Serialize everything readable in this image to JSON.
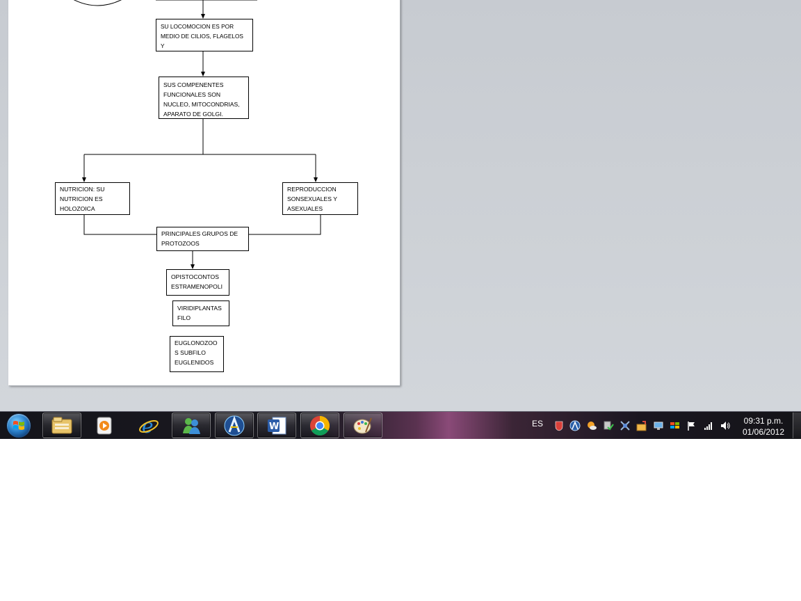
{
  "diagram": {
    "nodes": {
      "locomocion": "SU LOCOMOCION ES POR\nMEDIO DE CILIOS, FLAGELOS Y\nPSEUDOPODOS",
      "componentes": "SUS COMPENENTES\nFUNCIONALES SON\nNUCLEO, MITOCONDRIAS,\nAPARATO DE GOLGI.",
      "nutricion": "NUTRICION: SU\nNUTRICION ES\nHOLOZOICA",
      "reproduccion": "REPRODUCCION\nSONSEXUALES Y\nASEXUALES",
      "grupos": "PRINCIPALES GRUPOS DE\nPROTOZOOS",
      "opistocontos": "OPISTOCONTOS\nESTRAMENOPOLI",
      "viridiplantas": "VIRIDIPLANTAS\nFILO",
      "euglenozoos": "EUGLONOZOO\nS SUBFILO\nEUGLENIDOS"
    }
  },
  "taskbar": {
    "apps": [
      {
        "name": "explorer",
        "icon": "folder-icon",
        "open": true
      },
      {
        "name": "media-player",
        "icon": "media-player-icon",
        "open": false
      },
      {
        "name": "internet-explorer",
        "icon": "ie-icon",
        "open": false
      },
      {
        "name": "messenger",
        "icon": "messenger-icon",
        "open": true
      },
      {
        "name": "arcsoft",
        "icon": "arc-logo-icon",
        "open": true
      },
      {
        "name": "word",
        "icon": "word-icon",
        "open": true
      },
      {
        "name": "chrome",
        "icon": "chrome-icon",
        "open": true
      },
      {
        "name": "paint",
        "icon": "paint-palette-icon",
        "open": true
      }
    ],
    "tray": {
      "language": "ES",
      "icons": [
        "shield-icon",
        "arc-tray-icon",
        "weather-icon",
        "security-check-icon",
        "network-tool-icon",
        "folder-share-icon",
        "display-icon",
        "windows-flag-icon",
        "action-center-flag-icon",
        "signal-icon",
        "speaker-icon"
      ]
    },
    "clock": {
      "time": "09:31 p.m.",
      "date": "01/06/2012"
    }
  },
  "colors": {
    "workspace": "#c9cdd2",
    "taskbar_accent": "#8a4a78"
  }
}
